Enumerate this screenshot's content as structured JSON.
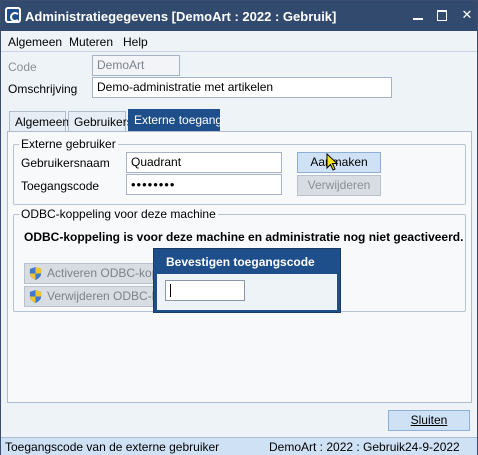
{
  "window": {
    "title": "Administratiegegevens  [DemoArt : 2022 : Gebruik]",
    "minimize_glyph": "",
    "maximize_glyph": "",
    "close_glyph": "✕"
  },
  "menu": [
    "Algemeen",
    "Muteren",
    "Help"
  ],
  "form": {
    "code_label": "Code",
    "code_value": "DemoArt",
    "description_label": "Omschrijving",
    "description_value": "Demo-administratie met artikelen"
  },
  "tabs": [
    "Algemeen",
    "Gebruikers",
    "Externe toegang"
  ],
  "external_user": {
    "group_title": "Externe gebruiker",
    "username_label": "Gebruikersnaam",
    "username_value": "Quadrant",
    "access_code_label": "Toegangscode",
    "access_code_value": "••••••••",
    "create_button": "Aanmaken",
    "delete_button": "Verwijderen"
  },
  "odbc": {
    "group_title": "ODBC-koppeling voor deze machine",
    "message": "ODBC-koppeling is voor deze machine en administratie nog niet geactiveerd.",
    "activate_button": "Activeren ODBC-koppeling",
    "remove_button": "Verwijderen ODBC-koppeling"
  },
  "dialog": {
    "title": "Bevestigen toegangscode",
    "input_value": ""
  },
  "close_button": "Sluiten",
  "status": {
    "hint": "Toegangscode van de externe gebruiker",
    "context": "DemoArt : 2022 : Gebruik",
    "date": "24-9-2022"
  },
  "colors": {
    "titlebar": "#324a6d",
    "accent": "#1f4f8a",
    "statusbar": "#cfe1f5"
  }
}
